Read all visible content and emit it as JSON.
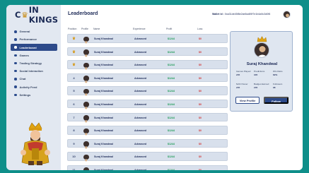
{
  "brand": {
    "logo_pre": "C",
    "logo_post": "IN KINGS"
  },
  "sidebar": {
    "items": [
      {
        "label": "General",
        "active": false
      },
      {
        "label": "Performance",
        "active": false
      },
      {
        "label": "Leaderboard",
        "active": true
      },
      {
        "label": "Games",
        "active": false
      },
      {
        "label": "Trading Strategy",
        "active": false
      },
      {
        "label": "Social Interaction",
        "active": false
      },
      {
        "label": "Chat",
        "active": false
      },
      {
        "label": "Activity Feed",
        "active": false
      },
      {
        "label": "Settings",
        "active": false
      }
    ]
  },
  "header": {
    "title": "Leaderboard",
    "wallet_label": "Wallet Id :",
    "wallet_id": "0xa31de45f8e2ab5cd89f7e1b4a9c3d0f6"
  },
  "table": {
    "columns": [
      "Position",
      "Profile",
      "Name",
      "Experience",
      "Profit",
      "Loss"
    ],
    "rows": [
      {
        "rank": "♛",
        "name": "Suraj Khandwal",
        "experience": "Advanced",
        "profit": "$1244",
        "loss": "$0"
      },
      {
        "rank": "♛",
        "name": "Suraj Khandwal",
        "experience": "Advanced",
        "profit": "$1244",
        "loss": "$0"
      },
      {
        "rank": "♛",
        "name": "Suraj Khandwal",
        "experience": "Advanced",
        "profit": "$1244",
        "loss": "$0"
      },
      {
        "rank": "4",
        "name": "Suraj Khandwal",
        "experience": "Advanced",
        "profit": "$1244",
        "loss": "$0"
      },
      {
        "rank": "5",
        "name": "Suraj Khandwal",
        "experience": "Advanced",
        "profit": "$1244",
        "loss": "$0"
      },
      {
        "rank": "6",
        "name": "Suraj Khandwal",
        "experience": "Advanced",
        "profit": "$1244",
        "loss": "$0"
      },
      {
        "rank": "7",
        "name": "Suraj Khandwal",
        "experience": "Advanced",
        "profit": "$1244",
        "loss": "$0"
      },
      {
        "rank": "8",
        "name": "Suraj Khandwal",
        "experience": "Advanced",
        "profit": "$1244",
        "loss": "$0"
      },
      {
        "rank": "9",
        "name": "Suraj Khandwal",
        "experience": "Advanced",
        "profit": "$1244",
        "loss": "$0"
      },
      {
        "rank": "10",
        "name": "Suraj Khandwal",
        "experience": "Advanced",
        "profit": "$1244",
        "loss": "$0"
      },
      {
        "rank": "11",
        "name": "Suraj Khandwal",
        "experience": "Advanced",
        "profit": "$1244",
        "loss": "$0"
      }
    ]
  },
  "profile": {
    "name": "Suraj Khandwal",
    "stats": [
      {
        "label": "Games Played",
        "value": "245"
      },
      {
        "label": "Predictions",
        "value": "345"
      },
      {
        "label": "W/L Ratio",
        "value": "82%"
      },
      {
        "label": "NAN Owner",
        "value": "245"
      },
      {
        "label": "Badges Earned",
        "value": "245"
      },
      {
        "label": "Followers",
        "value": "98"
      }
    ],
    "view_label": "View Profile",
    "follow_label": "Follow"
  },
  "colors": {
    "background": "#0f8f8a",
    "accent": "#2d4a8a",
    "profit": "#1c9a55",
    "loss": "#d23b3b",
    "gold": "#d59712"
  }
}
